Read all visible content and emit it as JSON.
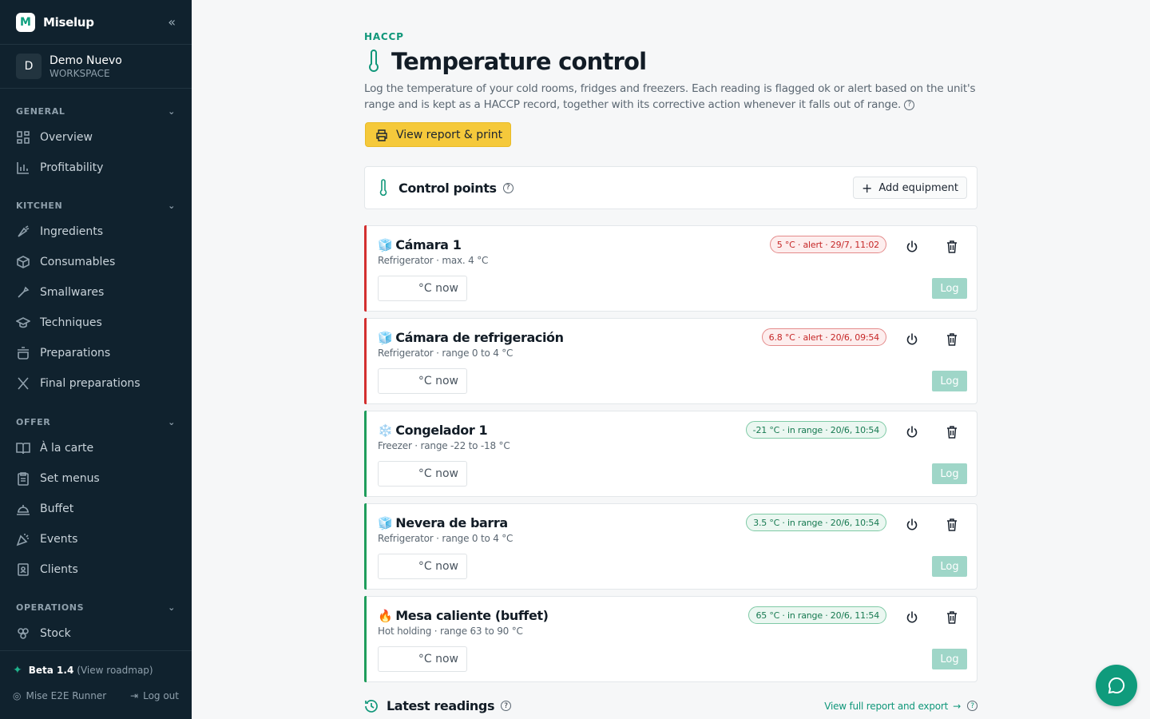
{
  "app": {
    "name": "Miselup",
    "logo_letter": "M"
  },
  "workspace": {
    "initial": "D",
    "name": "Demo Nuevo",
    "type": "WORKSPACE"
  },
  "sidebar": {
    "sections": [
      {
        "title": "GENERAL",
        "items": [
          {
            "label": "Overview",
            "icon": "grid-icon"
          },
          {
            "label": "Profitability",
            "icon": "bar-chart-icon"
          }
        ]
      },
      {
        "title": "KITCHEN",
        "items": [
          {
            "label": "Ingredients",
            "icon": "carrot-icon"
          },
          {
            "label": "Consumables",
            "icon": "box-icon"
          },
          {
            "label": "Smallwares",
            "icon": "utensil-icon"
          },
          {
            "label": "Techniques",
            "icon": "graduation-cap-icon"
          },
          {
            "label": "Preparations",
            "icon": "pot-icon"
          },
          {
            "label": "Final preparations",
            "icon": "fork-knife-icon"
          }
        ]
      },
      {
        "title": "OFFER",
        "items": [
          {
            "label": "À la carte",
            "icon": "book-open-icon"
          },
          {
            "label": "Set menus",
            "icon": "clipboard-icon"
          },
          {
            "label": "Buffet",
            "icon": "cloche-icon"
          },
          {
            "label": "Events",
            "icon": "party-icon"
          },
          {
            "label": "Clients",
            "icon": "contact-icon"
          }
        ]
      },
      {
        "title": "OPERATIONS",
        "items": [
          {
            "label": "Stock",
            "icon": "boxes-icon"
          }
        ]
      }
    ],
    "footer": {
      "beta": "Beta 1.4",
      "roadmap": "(View roadmap)",
      "user": "Mise E2E Runner",
      "logout": "Log out"
    }
  },
  "header": {
    "eyebrow": "HACCP",
    "title": "Temperature control",
    "description": "Log the temperature of your cold rooms, fridges and freezers. Each reading is flagged ok or alert based on the unit's range and is kept as a HACCP record, together with its corrective action whenever it falls out of range.",
    "report_button": "View report & print"
  },
  "control_points": {
    "title": "Control points",
    "add_button": "Add equipment",
    "equipment": [
      {
        "emoji": "🧊",
        "name": "Cámara 1",
        "details": "Refrigerator · max. 4 °C",
        "status": "alert",
        "badge": "5 °C · alert · 29/7, 11:02",
        "input_suffix": "°C now",
        "log_label": "Log"
      },
      {
        "emoji": "🧊",
        "name": "Cámara de refrigeración",
        "details": "Refrigerator · range 0 to 4 °C",
        "status": "alert",
        "badge": "6.8 °C · alert · 20/6, 09:54",
        "input_suffix": "°C now",
        "log_label": "Log"
      },
      {
        "emoji": "❄️",
        "name": "Congelador 1",
        "details": "Freezer · range -22 to -18 °C",
        "status": "ok",
        "badge": "-21 °C · in range · 20/6, 10:54",
        "input_suffix": "°C now",
        "log_label": "Log"
      },
      {
        "emoji": "🧊",
        "name": "Nevera de barra",
        "details": "Refrigerator · range 0 to 4 °C",
        "status": "ok",
        "badge": "3.5 °C · in range · 20/6, 10:54",
        "input_suffix": "°C now",
        "log_label": "Log"
      },
      {
        "emoji": "🔥",
        "name": "Mesa caliente (buffet)",
        "details": "Hot holding · range 63 to 90 °C",
        "status": "ok",
        "badge": "65 °C · in range · 20/6, 11:54",
        "input_suffix": "°C now",
        "log_label": "Log"
      }
    ]
  },
  "latest": {
    "title": "Latest readings",
    "link": "View full report and export"
  },
  "colors": {
    "accent": "#10977a",
    "alert": "#d32f2f",
    "ok": "#1f9d5c",
    "sidebar": "#10222e",
    "cta": "#f5c93b"
  }
}
